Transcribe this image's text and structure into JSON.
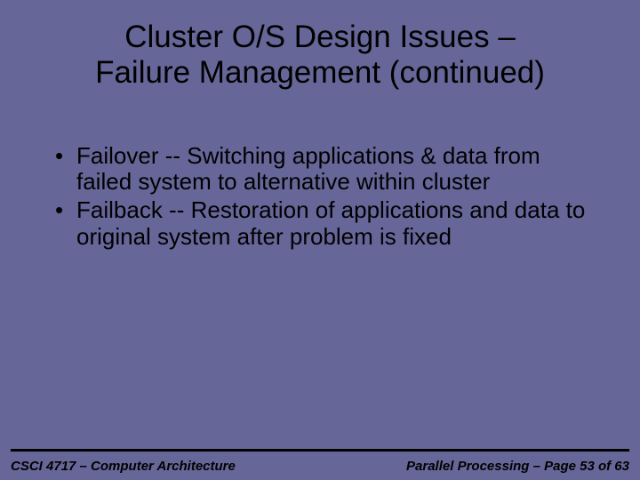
{
  "title_line1": "Cluster O/S Design Issues –",
  "title_line2": "Failure Management (continued)",
  "bullets": [
    "Failover -- Switching applications & data from failed system to alternative within cluster",
    "Failback -- Restoration of applications and data to original system after problem is fixed"
  ],
  "footer": {
    "left": "CSCI 4717 – Computer Architecture",
    "right": "Parallel Processing – Page 53 of 63"
  }
}
